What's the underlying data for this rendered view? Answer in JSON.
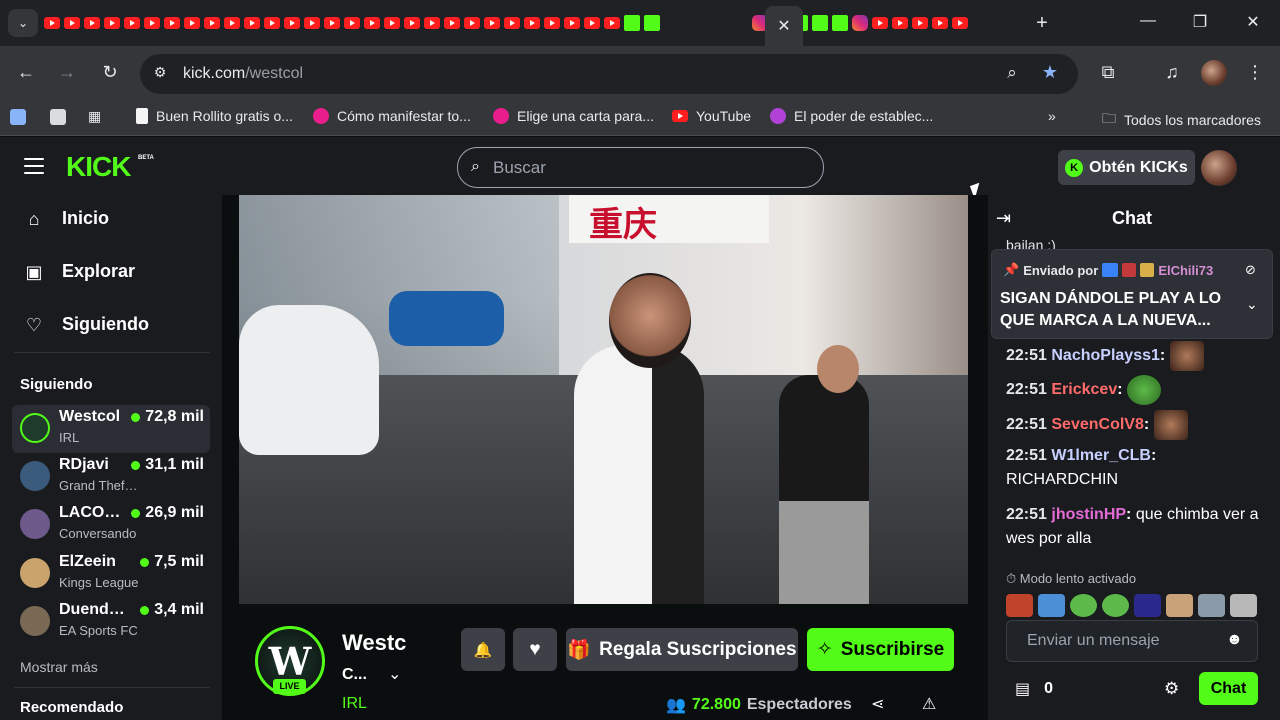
{
  "browser": {
    "url_domain": "kick.com",
    "url_path": "/westcol",
    "close_tab_symbol": "✕",
    "bookmarks": [
      {
        "label": "Buen Rollito gratis o...",
        "color": "#f5f5f5"
      },
      {
        "label": "Cómo manifestar to...",
        "color": "#e91e8c"
      },
      {
        "label": "Elige una carta para...",
        "color": "#e91e8c"
      },
      {
        "label": "YouTube",
        "color": "#ff1f1f"
      },
      {
        "label": "El poder de establec...",
        "color": "#b042d6"
      }
    ],
    "all_bookmarks": "Todos los marcadores",
    "overflow": "»"
  },
  "header": {
    "logo": "KICK",
    "beta": "BETA",
    "search_placeholder": "Buscar",
    "get_kicks": "Obtén KICKs"
  },
  "sidebar": {
    "nav": [
      {
        "label": "Inicio",
        "icon": "home-icon"
      },
      {
        "label": "Explorar",
        "icon": "explore-icon"
      },
      {
        "label": "Siguiendo",
        "icon": "heart-icon"
      }
    ],
    "following_title": "Siguiendo",
    "following": [
      {
        "name": "Westcol",
        "category": "IRL",
        "viewers": "72,8 mil",
        "color": "#1e3b2c"
      },
      {
        "name": "RDjavi",
        "category": "Grand Theft Auto V",
        "viewers": "31,1 mil",
        "color": "#3b5b7c"
      },
      {
        "name": "LACOBRAAA",
        "category": "Conversando",
        "viewers": "26,9 mil",
        "color": "#6d5a8a"
      },
      {
        "name": "ElZeein",
        "category": "Kings League",
        "viewers": "7,5 mil",
        "color": "#c9a26c"
      },
      {
        "name": "DuendePablo",
        "category": "EA Sports FC",
        "viewers": "3,4 mil",
        "color": "#7a6a55"
      }
    ],
    "show_more": "Mostrar más",
    "recommended_title": "Recomendado"
  },
  "channel": {
    "name": "Westc",
    "title_short": "C...",
    "category": "IRL",
    "live_badge": "LIVE",
    "avatar_letter": "W",
    "gift_label": "Regala Suscripciones",
    "subscribe_label": "Suscribirse",
    "viewers_number": "72.800",
    "viewers_label": "Espectadores"
  },
  "video": {
    "sign_text": "重庆"
  },
  "chat": {
    "title": "Chat",
    "partial_top": "bailan :)",
    "pinned": {
      "sent_by": "Enviado por",
      "user": "ElChili73",
      "message": "SIGAN DÁNDOLE PLAY A LO QUE MARCA A LA NUEVA..."
    },
    "messages": [
      {
        "time": "22:51",
        "user": "NachoPlayss1",
        "color": "#c8d0ff",
        "text": ""
      },
      {
        "time": "22:51",
        "user": "Erickcev",
        "color": "#ff6b6b",
        "text": ""
      },
      {
        "time": "22:51",
        "user": "SevenColV8",
        "color": "#ff6b6b",
        "text": ""
      },
      {
        "time": "22:51",
        "user": "W1lmer_CLB",
        "color": "#c8d0ff",
        "text": "RICHARDCHIN"
      },
      {
        "time": "22:51",
        "user": "jhostinHP",
        "color": "#e56bd6",
        "text": "que chimba ver a wes por alla"
      }
    ],
    "slow_mode": "Modo lento activado",
    "input_placeholder": "Enviar un mensaje",
    "kicks_balance": "0",
    "send_label": "Chat"
  }
}
